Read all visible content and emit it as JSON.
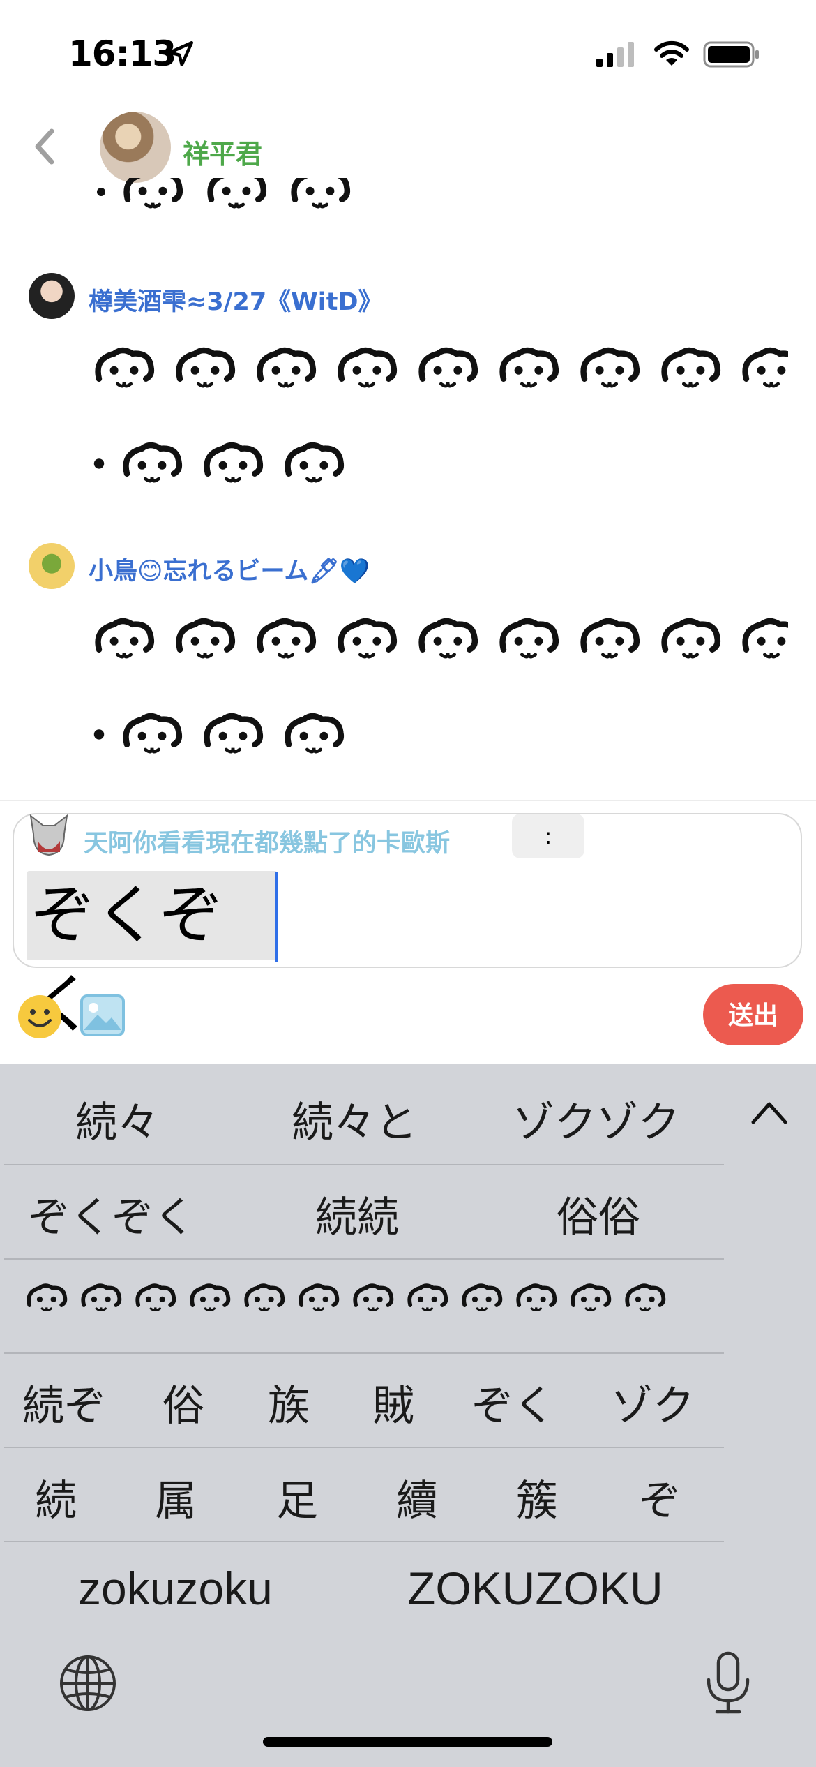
{
  "status_bar": {
    "time": "16:13",
    "icons": [
      "location-arrow-icon",
      "cellular-signal-icon",
      "wifi-icon",
      "battery-icon"
    ]
  },
  "header": {
    "name": "祥平君",
    "name_color": "#4ea84a",
    "icons": [
      "back-chevron-icon"
    ]
  },
  "messages": [
    {
      "name": "樽美酒雫≈3/27《WitD》",
      "faces_line1": 9,
      "faces_line2": 3
    },
    {
      "name": "小鳥😊忘れるビーム🖋💙",
      "faces_line1": 9,
      "faces_line2": 3
    }
  ],
  "composer": {
    "reply_name": "天阿你看看現在都幾點了的卡歐斯",
    "reply_chip": ":",
    "input_text": "ぞくぞく",
    "send_label": "送出",
    "send_color": "#ec5a4f",
    "icons": [
      "smiley-icon",
      "image-icon"
    ]
  },
  "keyboard": {
    "row1": [
      "続々",
      "続々と",
      "ゾクゾク"
    ],
    "row2": [
      "ぞくぞく",
      "続続",
      "俗俗"
    ],
    "row4": [
      "続ぞ",
      "俗",
      "族",
      "賊",
      "ぞく",
      "ゾク"
    ],
    "row5": [
      "続",
      "属",
      "足",
      "續",
      "簇",
      "ぞ"
    ],
    "row6": [
      "zokuzoku",
      "ZOKUZOKU"
    ],
    "icons": [
      "chevron-up-icon",
      "globe-icon",
      "microphone-icon"
    ],
    "background": "#d2d4d9"
  },
  "emoticon_row_faces": 12
}
